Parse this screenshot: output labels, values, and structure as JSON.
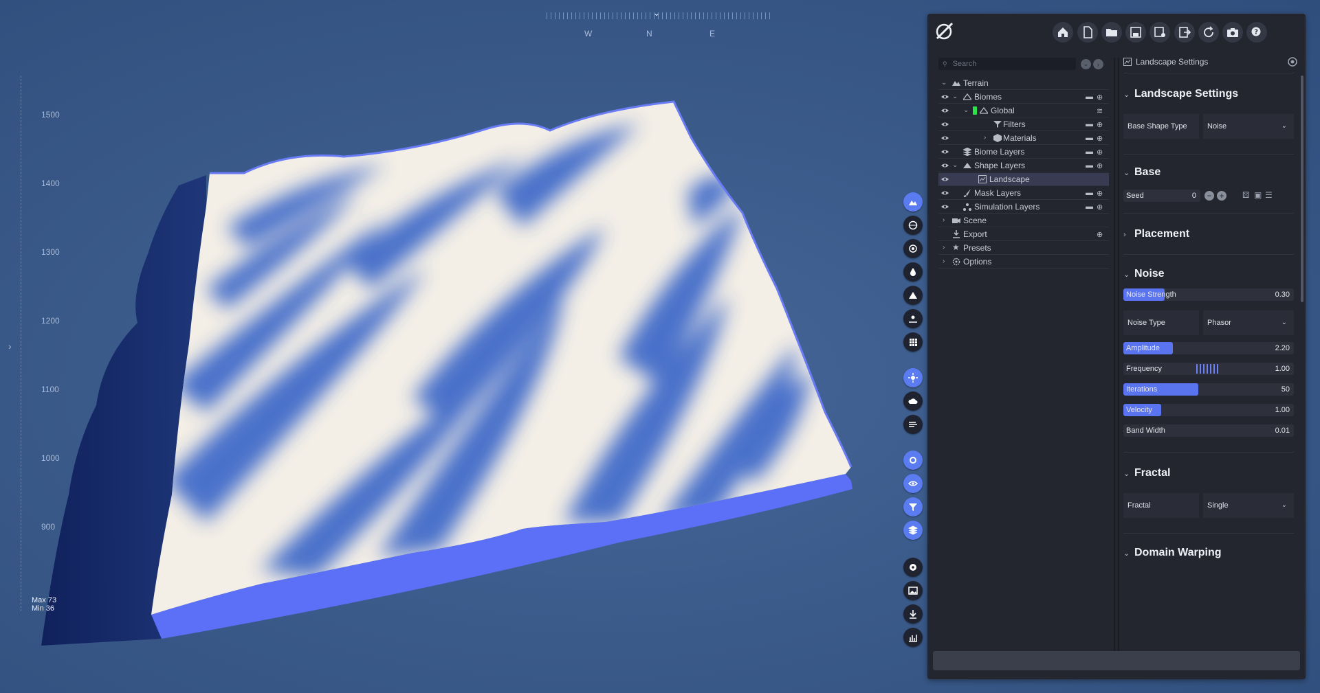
{
  "viewport": {
    "ruler_labels": [
      "1500",
      "1400",
      "1300",
      "1200",
      "1100",
      "1000",
      "900"
    ],
    "max_text": "Max 73",
    "min_text": "Min 36",
    "compass": {
      "w": "W",
      "n": "N",
      "e": "E"
    }
  },
  "toolbar_icons": [
    "terrain-icon",
    "globe-icon",
    "camera-icon",
    "water-icon",
    "mountain-icon",
    "scene-icon",
    "grid-icon",
    "sun-icon",
    "cloud-icon",
    "wind-icon",
    "settings-icon",
    "eye-icon",
    "filter-icon",
    "layers-icon",
    "record-icon",
    "image-icon",
    "download-icon",
    "stats-icon"
  ],
  "top_icons": [
    "home-icon",
    "new-file-icon",
    "open-folder-icon",
    "save-icon",
    "save-as-icon",
    "export-icon",
    "refresh-icon",
    "screenshot-icon",
    "help-icon"
  ],
  "tree": {
    "search_placeholder": "Search",
    "rows": [
      {
        "label": "Terrain"
      },
      {
        "label": "Biomes"
      },
      {
        "label": "Global"
      },
      {
        "label": "Filters"
      },
      {
        "label": "Materials"
      },
      {
        "label": "Biome Layers"
      },
      {
        "label": "Shape Layers"
      },
      {
        "label": "Landscape"
      },
      {
        "label": "Mask Layers"
      },
      {
        "label": "Simulation Layers"
      },
      {
        "label": "Scene"
      },
      {
        "label": "Export"
      },
      {
        "label": "Presets"
      },
      {
        "label": "Options"
      }
    ]
  },
  "settings": {
    "header": "Landscape Settings",
    "section_landscape": "Landscape Settings",
    "base_shape_label": "Base Shape Type",
    "base_shape_value": "Noise",
    "section_base": "Base",
    "seed_label": "Seed",
    "seed_value": "0",
    "section_placement": "Placement",
    "section_noise": "Noise",
    "noise_strength": {
      "label": "Noise Strength",
      "value": "0.30",
      "fraction": 0.24
    },
    "noise_type_label": "Noise Type",
    "noise_type_value": "Phasor",
    "amplitude": {
      "label": "Amplitude",
      "value": "2.20",
      "fraction": 0.29
    },
    "frequency": {
      "label": "Frequency",
      "value": "1.00"
    },
    "iterations": {
      "label": "Iterations",
      "value": "50",
      "fraction": 0.44
    },
    "velocity": {
      "label": "Velocity",
      "value": "1.00",
      "fraction": 0.22
    },
    "band_width": {
      "label": "Band Width",
      "value": "0.01",
      "fraction": 0.0
    },
    "section_fractal": "Fractal",
    "fractal_label": "Fractal",
    "fractal_value": "Single",
    "section_domain_warping": "Domain Warping"
  },
  "colors": {
    "accent": "#5a74f0",
    "panel": "#23262f",
    "sky": "#3a5a8a",
    "terrain": "#f3eee6",
    "shadow": "#3b66c6"
  }
}
